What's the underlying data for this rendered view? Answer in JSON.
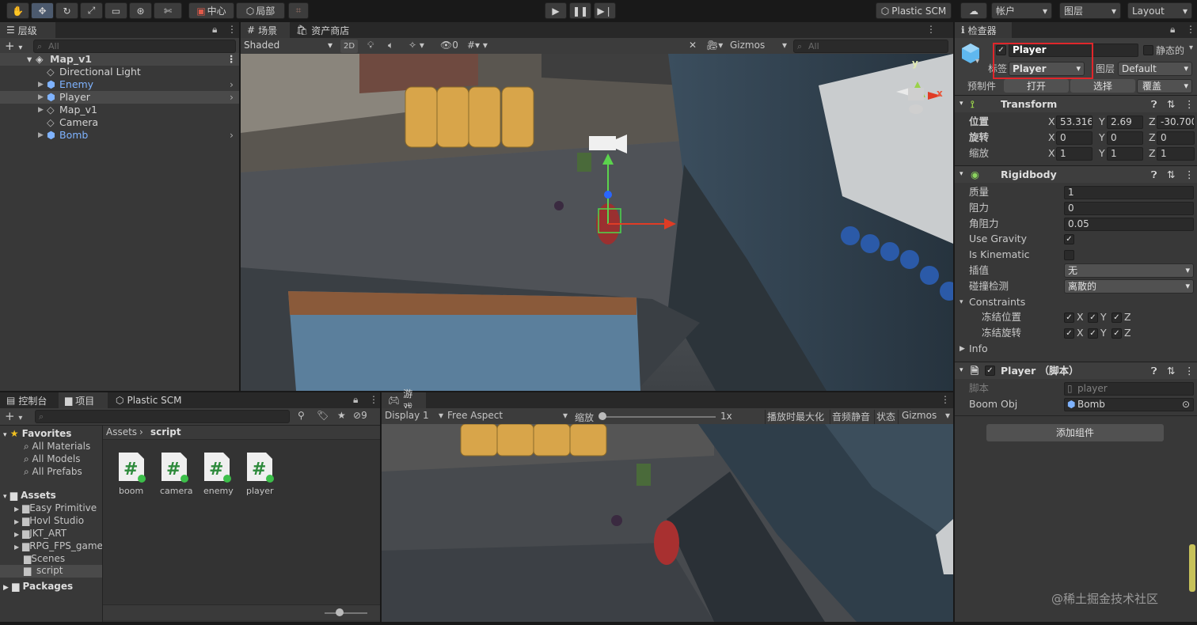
{
  "toolbar": {
    "pivot_center": "中心",
    "pivot_local": "局部",
    "plastic_scm": "Plastic SCM",
    "account": "帐户",
    "layers": "图层",
    "layout": "Layout"
  },
  "hierarchy": {
    "tab": "层级",
    "search_placeholder": "All",
    "scene": "Map_v1",
    "items": [
      {
        "label": "Directional Light",
        "prefab": false
      },
      {
        "label": "Enemy",
        "prefab": true
      },
      {
        "label": "Player",
        "prefab": true
      },
      {
        "label": "Map_v1",
        "prefab": false
      },
      {
        "label": "Camera",
        "prefab": false
      },
      {
        "label": "Bomb",
        "prefab": true
      }
    ]
  },
  "scene": {
    "tab": "场景",
    "tab2": "资产商店",
    "shading": "Shaded",
    "mode2d": "2D",
    "hidden_count": "0",
    "gizmos": "Gizmos",
    "search_placeholder": "All",
    "axis_x": "x",
    "axis_y": "y"
  },
  "project": {
    "tab_console": "控制台",
    "tab_project": "项目",
    "tab_plastic": "Plastic SCM",
    "hidden_count": "9",
    "favorites": "Favorites",
    "fav_items": [
      "All Materials",
      "All Models",
      "All Prefabs"
    ],
    "assets": "Assets",
    "asset_folders": [
      "Easy Primitive",
      "Hovl Studio",
      "JKT_ART",
      "RPG_FPS_game",
      "Scenes",
      "script"
    ],
    "packages": "Packages",
    "breadcrumb_root": "Assets",
    "breadcrumb_leaf": "script",
    "files": [
      "boom",
      "camera",
      "enemy",
      "player"
    ]
  },
  "game": {
    "tab": "游戏",
    "display": "Display 1",
    "aspect": "Free Aspect",
    "scale_label": "缩放",
    "scale_value": "1x",
    "maximize": "播放时最大化",
    "mute": "音频静音",
    "stats": "状态",
    "gizmos": "Gizmos"
  },
  "inspector": {
    "tab": "检查器",
    "object_name": "Player",
    "static_label": "静态的",
    "tag_label": "标签",
    "tag_value": "Player",
    "layer_label": "图层",
    "layer_value": "Default",
    "prefab_label": "预制件",
    "open": "打开",
    "select": "选择",
    "overrides": "覆盖",
    "transform": {
      "title": "Transform",
      "position": "位置",
      "rotation": "旋转",
      "scale": "缩放",
      "pos": [
        "53.3164",
        "2.69",
        "-30.700"
      ],
      "rot": [
        "0",
        "0",
        "0"
      ],
      "scl": [
        "1",
        "1",
        "1"
      ]
    },
    "rigidbody": {
      "title": "Rigidbody",
      "mass_label": "质量",
      "mass": "1",
      "drag_label": "阻力",
      "drag": "0",
      "angdrag_label": "角阻力",
      "angdrag": "0.05",
      "gravity_label": "Use Gravity",
      "kinematic_label": "Is Kinematic",
      "interp_label": "插值",
      "interp": "无",
      "collision_label": "碰撞检测",
      "collision": "离散的",
      "constraints_label": "Constraints",
      "freeze_pos": "冻结位置",
      "freeze_rot": "冻结旋转",
      "info": "Info"
    },
    "script": {
      "title": "Player （脚本）",
      "script_label": "脚本",
      "script_value": "player",
      "boom_label": "Boom Obj",
      "boom_value": "Bomb"
    },
    "add_component": "添加组件"
  },
  "watermark": "@稀土掘金技术社区",
  "colors": {
    "accent_blue": "#7fb3ff",
    "highlight_red": "#e0262b",
    "green_script": "#2d8a3b"
  }
}
